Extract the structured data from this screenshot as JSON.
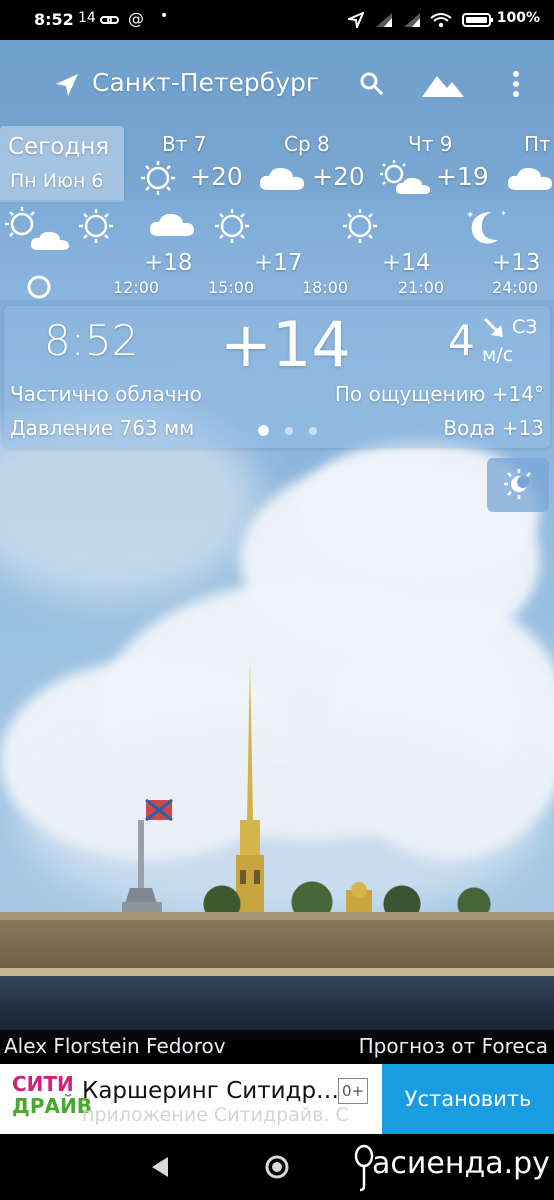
{
  "status_bar": {
    "time": "8:52",
    "left_extra": "14",
    "battery": "100%"
  },
  "toolbar": {
    "city": "Санкт-Петербург",
    "location_icon": "navigation-arrow-icon",
    "search_icon": "search-icon",
    "wallpaper_icon": "mountain-image-icon",
    "menu_icon": "more-vert-icon"
  },
  "days": [
    {
      "name": "Сегодня",
      "date": "Пн Июн 6",
      "icon": "partly-cloudy-icon",
      "temp": ""
    },
    {
      "name": "Вт 7",
      "icon": "sun-icon",
      "temp": "+20"
    },
    {
      "name": "Ср 8",
      "icon": "cloud-icon",
      "temp": "+20"
    },
    {
      "name": "Чт 9",
      "icon": "partly-cloudy-icon",
      "temp": "+19"
    },
    {
      "name": "Пт",
      "icon": "cloud-icon",
      "temp": ""
    }
  ],
  "hours": [
    {
      "time": "",
      "temp": "",
      "icon": "partly-cloudy-icon"
    },
    {
      "time": "12:00",
      "temp": "+18",
      "icon": "sun-icon"
    },
    {
      "time": "15:00",
      "temp": "+17",
      "icon": "cloud-icon"
    },
    {
      "time": "18:00",
      "temp": "",
      "icon": "sun-icon"
    },
    {
      "time": "21:00",
      "temp": "+14",
      "icon": "sun-icon"
    },
    {
      "time": "24:00",
      "temp": "+13",
      "icon": "moon-stars-icon"
    }
  ],
  "hour_temps": [
    "+18",
    "+17",
    "+14",
    "+13"
  ],
  "hour_times": [
    "12:00",
    "15:00",
    "18:00",
    "21:00",
    "24:00"
  ],
  "current": {
    "time": "8:52",
    "temp": "+14",
    "wind_speed": "4",
    "wind_dir": "СЗ",
    "wind_unit": "м/с",
    "condition": "Частично облачно",
    "feels_like": "По ощущению +14°",
    "pressure": "Давление 763 мм",
    "water": "Вода +13"
  },
  "credits": {
    "photo": "Alex Florstein Fedorov",
    "provider": "Прогноз от Foreca"
  },
  "ad": {
    "logo_top": "СИТИ",
    "logo_bottom": "ДРАЙВ",
    "title": "Каршеринг Ситидр…",
    "subtitle": "приложение Ситидрайв. С",
    "age": "0+",
    "install": "Установить"
  },
  "watermark": "асиенда.ру",
  "colors": {
    "panel": "#96bee6",
    "ad_button": "#1a9ce0",
    "logo_pink": "#d1217a",
    "logo_green": "#49a82f"
  }
}
